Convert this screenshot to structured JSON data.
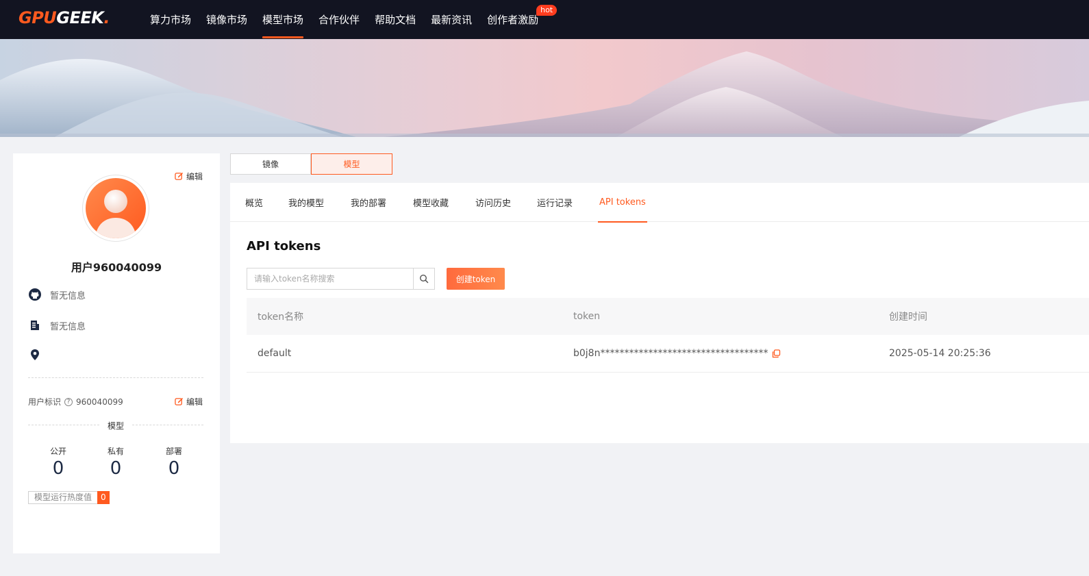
{
  "brand": {
    "part1": "GPU",
    "part2": "GEEK",
    "dot": "."
  },
  "nav": {
    "items": [
      {
        "label": "算力市场",
        "active": false
      },
      {
        "label": "镜像市场",
        "active": false
      },
      {
        "label": "模型市场",
        "active": true
      },
      {
        "label": "合作伙伴",
        "active": false
      },
      {
        "label": "帮助文档",
        "active": false
      },
      {
        "label": "最新资讯",
        "active": false
      },
      {
        "label": "创作者激励",
        "active": false,
        "badge": "hot"
      }
    ]
  },
  "profile": {
    "edit_label": "编辑",
    "username": "用户960040099",
    "github": "暂无信息",
    "company": "暂无信息",
    "location": "",
    "uid_label": "用户标识",
    "uid_value": "960040099",
    "uid_edit_label": "编辑",
    "section_title": "模型",
    "stats": [
      {
        "label": "公开",
        "value": "0"
      },
      {
        "label": "私有",
        "value": "0"
      },
      {
        "label": "部署",
        "value": "0"
      }
    ],
    "heat_label": "模型运行热度值",
    "heat_value": "0"
  },
  "segments": {
    "image": "镜像",
    "model": "模型",
    "active": "模型"
  },
  "tabs": [
    {
      "label": "概览",
      "active": false
    },
    {
      "label": "我的模型",
      "active": false
    },
    {
      "label": "我的部署",
      "active": false
    },
    {
      "label": "模型收藏",
      "active": false
    },
    {
      "label": "访问历史",
      "active": false
    },
    {
      "label": "运行记录",
      "active": false
    },
    {
      "label": "API tokens",
      "active": true
    }
  ],
  "content": {
    "title": "API tokens",
    "search_placeholder": "请输入token名称搜索",
    "create_button": "创建token",
    "table": {
      "headers": [
        "token名称",
        "token",
        "创建时间"
      ],
      "rows": [
        {
          "name": "default",
          "token": "b0j8n***********************************",
          "created": "2025-05-14 20:25:36"
        }
      ]
    }
  },
  "colors": {
    "accent": "#ff5a1f",
    "nav_bg": "#121421",
    "page_bg": "#f1f2f5"
  }
}
